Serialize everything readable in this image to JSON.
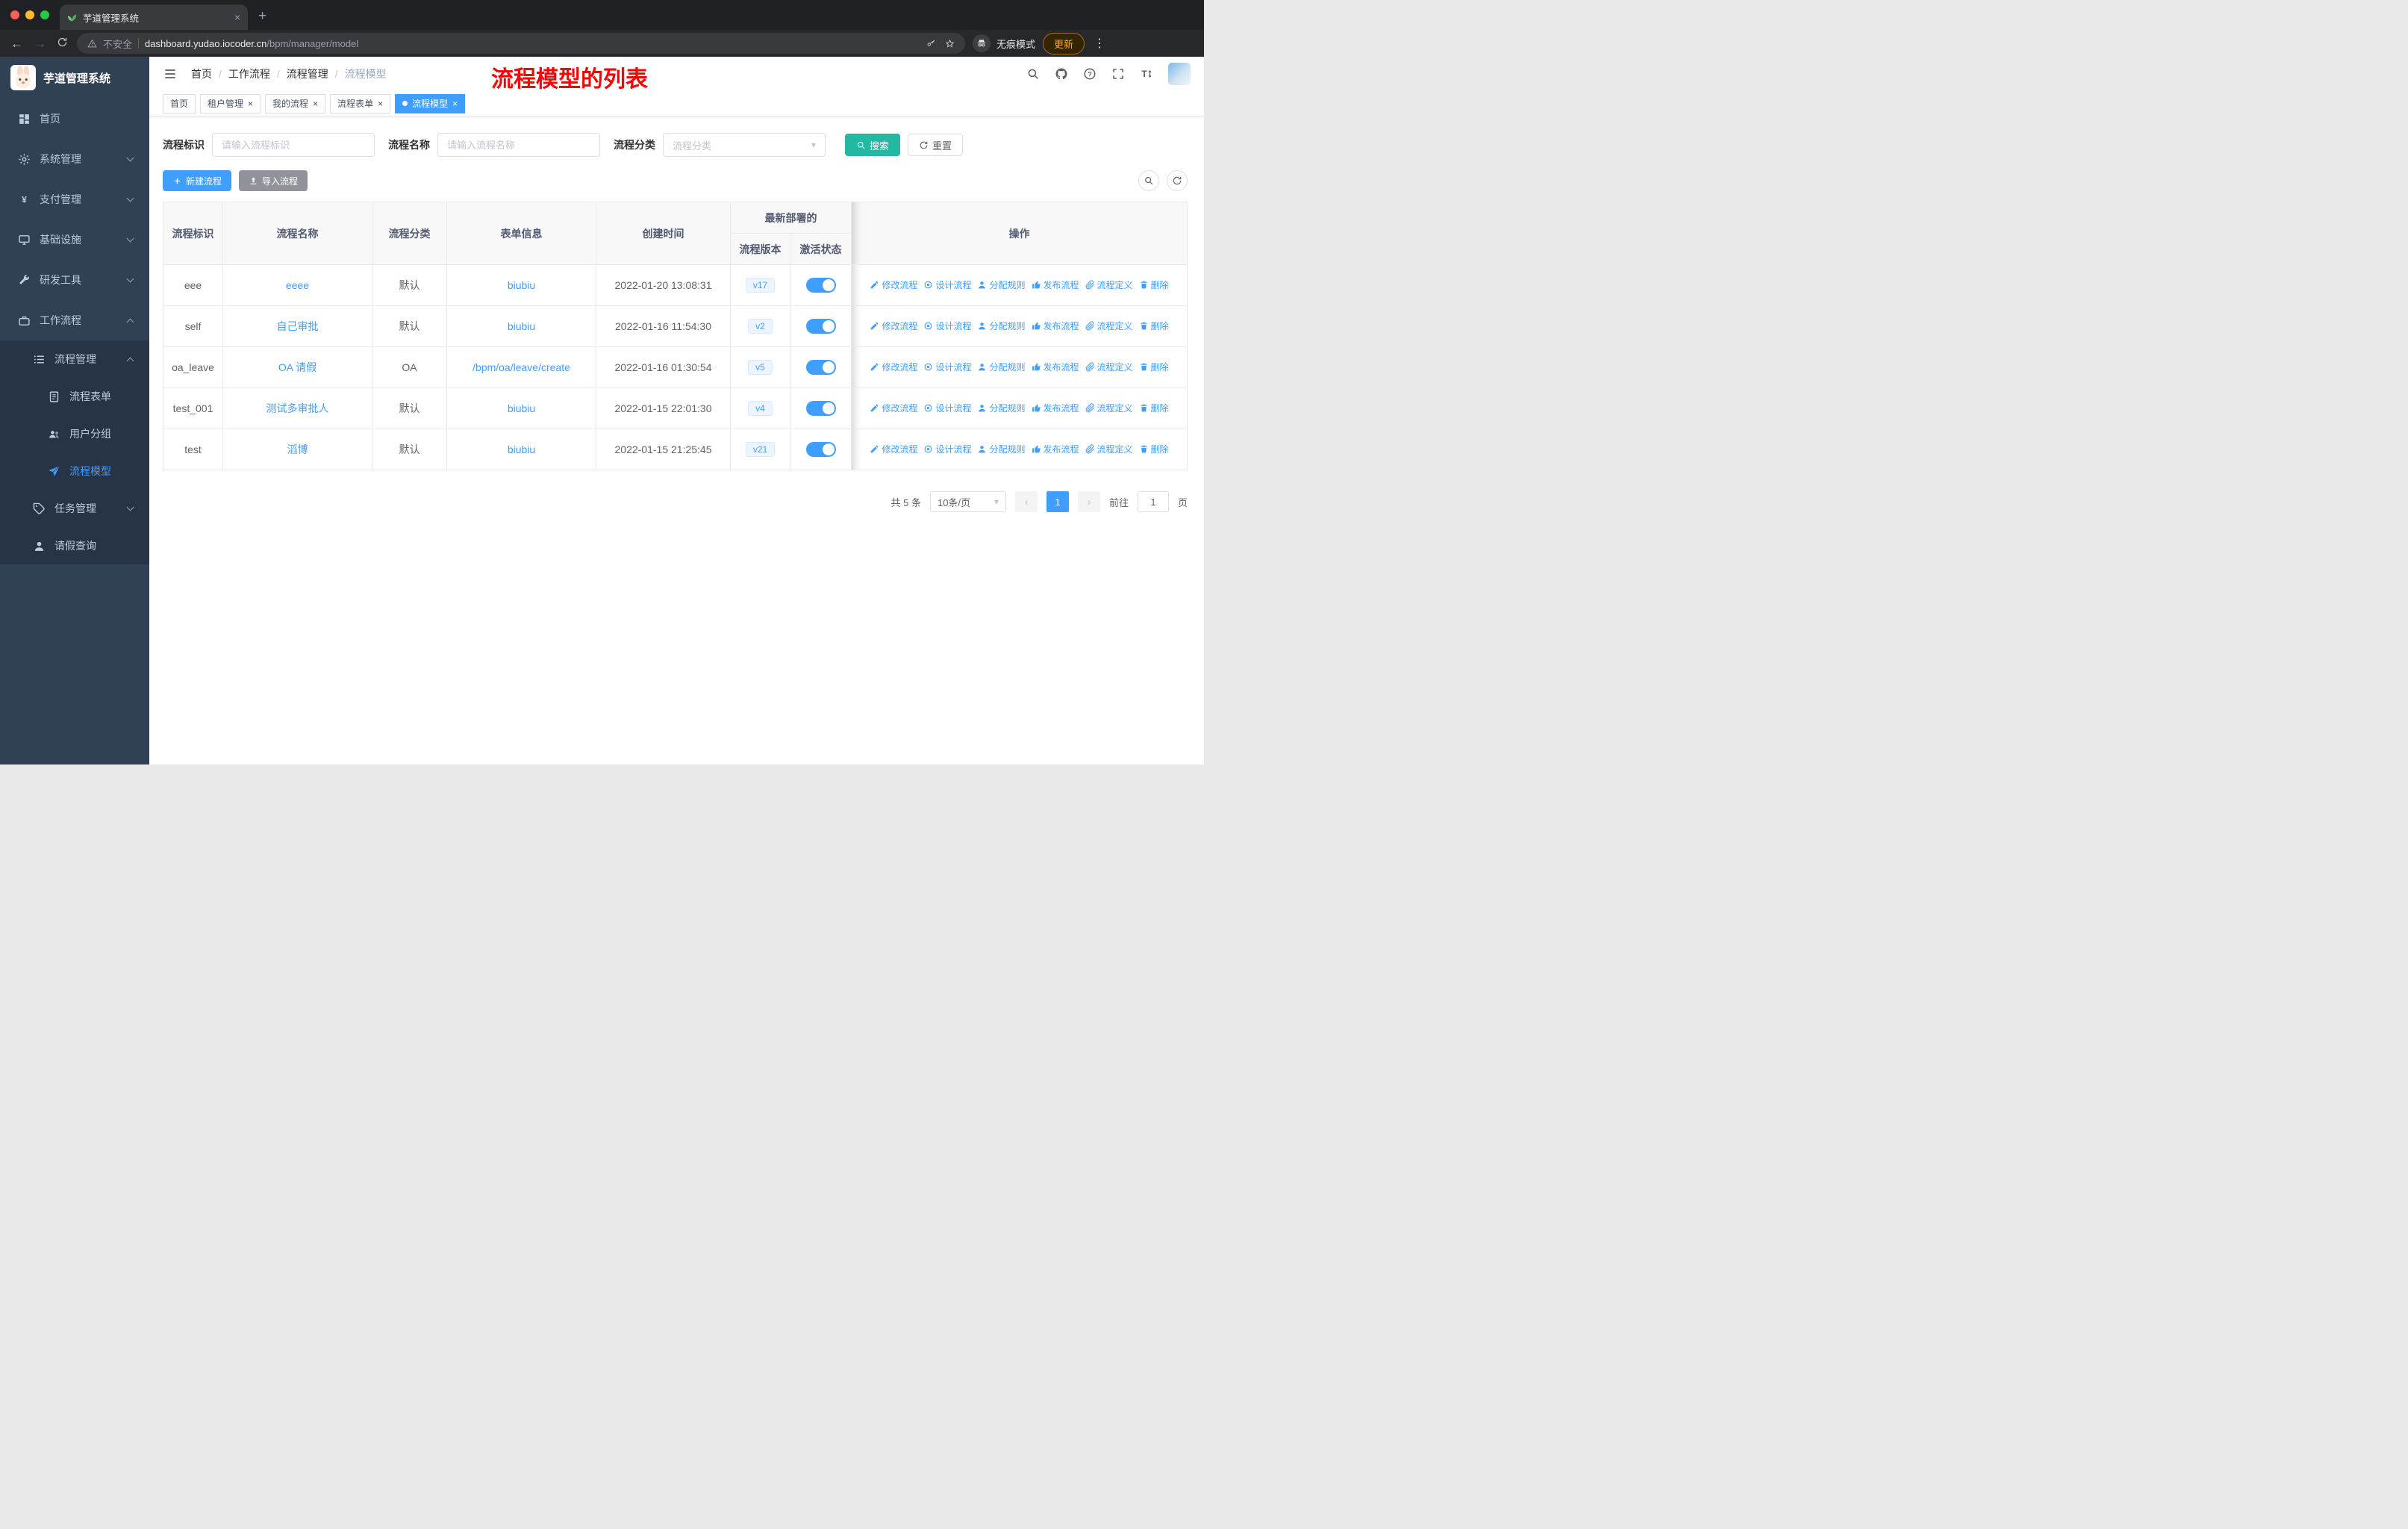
{
  "browser": {
    "tab_title": "芋道管理系统",
    "url_host": "dashboard.yudao.iocoder.cn",
    "url_path": "/bpm/manager/model",
    "not_secure": "不安全",
    "incognito": "无痕模式",
    "update": "更新"
  },
  "icons": {
    "close": "×",
    "plus": "+",
    "back": "←",
    "forward": "→",
    "dots": "⋮",
    "caret": "▾",
    "prev": "‹",
    "next": "›"
  },
  "sidebar": {
    "logo": "芋道管理系统",
    "home": "首页",
    "system": "系统管理",
    "pay": "支付管理",
    "infra": "基础设施",
    "dev": "研发工具",
    "workflow": "工作流程",
    "process": "流程管理",
    "form": "流程表单",
    "group": "用户分组",
    "model": "流程模型",
    "task": "任务管理",
    "leave": "请假查询"
  },
  "header": {
    "crumb1": "首页",
    "crumb2": "工作流程",
    "crumb3": "流程管理",
    "crumb4": "流程模型",
    "sep": "/",
    "annotation": "流程模型的列表"
  },
  "tags": {
    "t1": "首页",
    "t2": "租户管理",
    "t3": "我的流程",
    "t4": "流程表单",
    "t5": "流程模型"
  },
  "filter": {
    "key_label": "流程标识",
    "key_ph": "请输入流程标识",
    "name_label": "流程名称",
    "name_ph": "请输入流程名称",
    "cat_label": "流程分类",
    "cat_ph": "流程分类",
    "search": "搜索",
    "reset": "重置"
  },
  "toolbar": {
    "create": "新建流程",
    "import": "导入流程"
  },
  "table": {
    "h_key": "流程标识",
    "h_name": "流程名称",
    "h_cat": "流程分类",
    "h_form": "表单信息",
    "h_created": "创建时间",
    "h_deploy": "最新部署的",
    "h_version": "流程版本",
    "h_state": "激活状态",
    "h_ops": "操作",
    "op1": "修改流程",
    "op2": "设计流程",
    "op3": "分配规则",
    "op4": "发布流程",
    "op5": "流程定义",
    "op6": "删除",
    "rows": [
      {
        "key": "eee",
        "name": "eeee",
        "cat": "默认",
        "form": "biubiu",
        "created": "2022-01-20 13:08:31",
        "ver": "v17"
      },
      {
        "key": "self",
        "name": "自己审批",
        "cat": "默认",
        "form": "biubiu",
        "created": "2022-01-16 11:54:30",
        "ver": "v2"
      },
      {
        "key": "oa_leave",
        "name": "OA 请假",
        "cat": "OA",
        "form": "/bpm/oa/leave/create",
        "created": "2022-01-16 01:30:54",
        "ver": "v5"
      },
      {
        "key": "test_001",
        "name": "测试多审批人",
        "cat": "默认",
        "form": "biubiu",
        "created": "2022-01-15 22:01:30",
        "ver": "v4"
      },
      {
        "key": "test",
        "name": "滔博",
        "cat": "默认",
        "form": "biubiu",
        "created": "2022-01-15 21:25:45",
        "ver": "v21"
      }
    ]
  },
  "pagination": {
    "total": "共 5 条",
    "size": "10条/页",
    "page": "1",
    "goto": "前往",
    "goto_val": "1",
    "unit": "页"
  },
  "colors": {
    "accent": "#409eff",
    "search_button": "#23b8a2",
    "sidebar_bg": "#304156",
    "annotation_red": "#ff0000",
    "toggle_on": "#409eff"
  }
}
